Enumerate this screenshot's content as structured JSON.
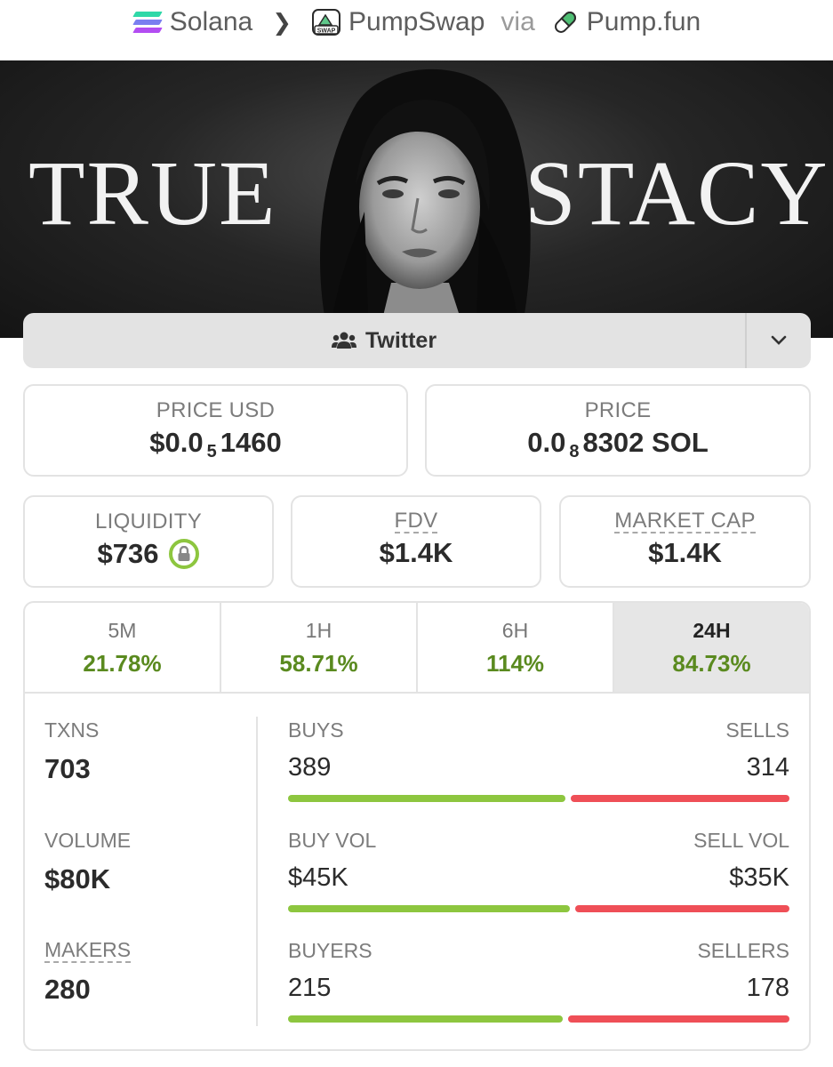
{
  "breadcrumb": {
    "chain": "Solana",
    "dex": "PumpSwap",
    "via": "via",
    "launchpad": "Pump.fun",
    "swap_badge": "SWAP"
  },
  "banner": {
    "left_word": "TRUE",
    "right_word": "STACY"
  },
  "social": {
    "label": "Twitter"
  },
  "prices": {
    "usd_label": "PRICE USD",
    "usd_prefix": "$0.0",
    "usd_zeros": "5",
    "usd_digits": "1460",
    "native_label": "PRICE",
    "native_prefix": "0.0",
    "native_zeros": "8",
    "native_digits": "8302 SOL"
  },
  "metrics": {
    "liquidity_label": "LIQUIDITY",
    "liquidity_value": "$736",
    "fdv_label": "FDV",
    "fdv_value": "$1.4K",
    "mcap_label": "MARKET CAP",
    "mcap_value": "$1.4K"
  },
  "timeframes": [
    {
      "label": "5M",
      "change": "21.78%"
    },
    {
      "label": "1H",
      "change": "58.71%"
    },
    {
      "label": "6H",
      "change": "114%"
    },
    {
      "label": "24H",
      "change": "84.73%",
      "active": true
    }
  ],
  "stats": {
    "txns_label": "TXNS",
    "txns": "703",
    "volume_label": "VOLUME",
    "volume": "$80K",
    "makers_label": "MAKERS",
    "makers": "280"
  },
  "splits": {
    "buys_label": "BUYS",
    "buys": "389",
    "sells_label": "SELLS",
    "sells": "314",
    "buy_vol_label": "BUY VOL",
    "buy_vol": "$45K",
    "sell_vol_label": "SELL VOL",
    "sell_vol": "$35K",
    "buyers_label": "BUYERS",
    "buyers": "215",
    "sellers_label": "SELLERS",
    "sellers": "178"
  },
  "split_fractions": {
    "buys": 0.553,
    "buy_vol": 0.5625,
    "buyers": 0.547
  },
  "colors": {
    "positive": "#5a8a1f",
    "buy_bar": "#8dc63f",
    "sell_bar": "#ef4f57"
  }
}
